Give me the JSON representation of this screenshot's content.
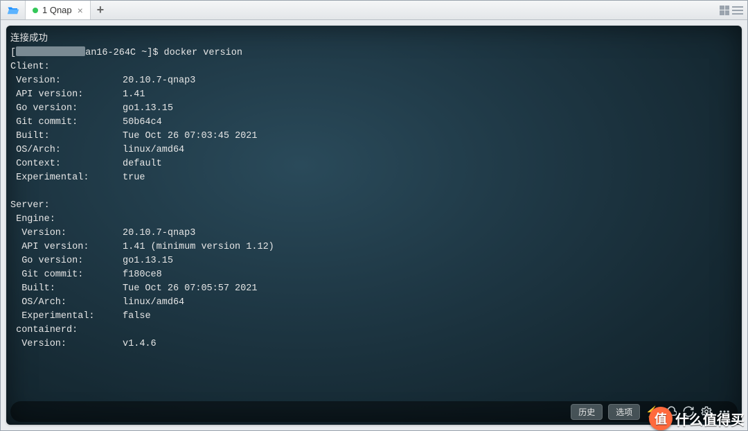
{
  "tab": {
    "label": "1 Qnap"
  },
  "terminal": {
    "status": "连接成功",
    "prompt_prefix": "[",
    "prompt_host_suffix": "an16-264C ~]$ ",
    "command": "docker version",
    "client_header": "Client:",
    "client": {
      "version_k": " Version:",
      "version_v": "20.10.7-qnap3",
      "api_k": " API version:",
      "api_v": "1.41",
      "go_k": " Go version:",
      "go_v": "go1.13.15",
      "git_k": " Git commit:",
      "git_v": "50b64c4",
      "built_k": " Built:",
      "built_v": "Tue Oct 26 07:03:45 2021",
      "os_k": " OS/Arch:",
      "os_v": "linux/amd64",
      "ctx_k": " Context:",
      "ctx_v": "default",
      "exp_k": " Experimental:",
      "exp_v": "true"
    },
    "server_header": "Server:",
    "engine_header": " Engine:",
    "engine": {
      "version_k": "  Version:",
      "version_v": "20.10.7-qnap3",
      "api_k": "  API version:",
      "api_v": "1.41 (minimum version 1.12)",
      "go_k": "  Go version:",
      "go_v": "go1.13.15",
      "git_k": "  Git commit:",
      "git_v": "f180ce8",
      "built_k": "  Built:",
      "built_v": "Tue Oct 26 07:05:57 2021",
      "os_k": "  OS/Arch:",
      "os_v": "linux/amd64",
      "exp_k": "  Experimental:",
      "exp_v": "false"
    },
    "containerd_header": " containerd:",
    "containerd": {
      "version_k": "  Version:",
      "version_v": "v1.4.6"
    }
  },
  "bottom": {
    "history": "历史",
    "options": "选项"
  },
  "watermark": {
    "text": "什么值得买",
    "badge": "值"
  }
}
